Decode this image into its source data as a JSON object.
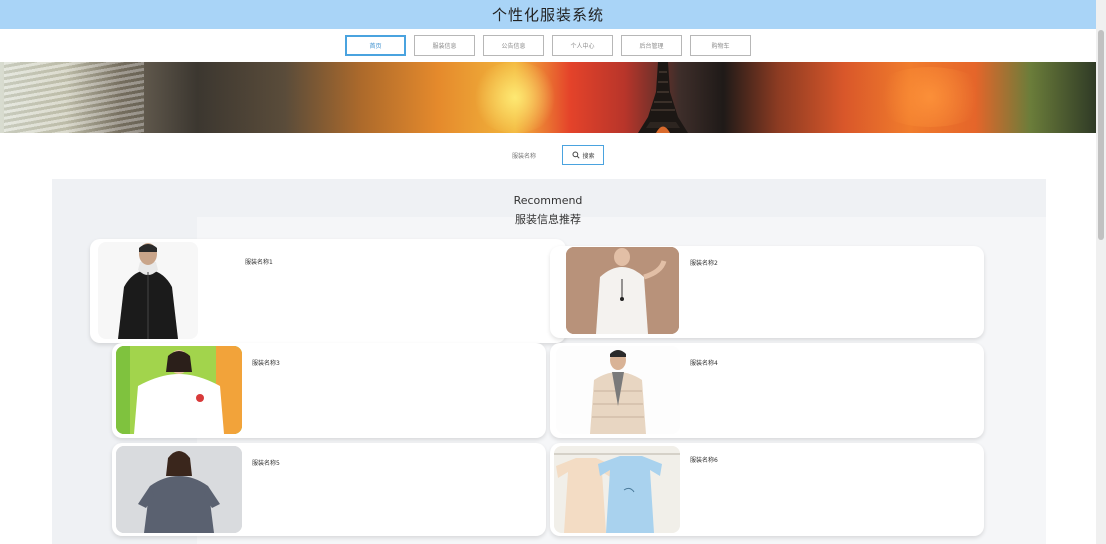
{
  "header": {
    "title": "个性化服装系统"
  },
  "nav": {
    "items": [
      {
        "label": "首页",
        "active": true
      },
      {
        "label": "服装信息",
        "active": false
      },
      {
        "label": "公告信息",
        "active": false
      },
      {
        "label": "个人中心",
        "active": false
      },
      {
        "label": "后台管理",
        "active": false
      },
      {
        "label": "购物车",
        "active": false
      }
    ]
  },
  "search": {
    "label": "服装名称",
    "button_label": "搜索",
    "icon": "search-icon"
  },
  "recommend": {
    "title_en": "Recommend",
    "title_cn": "服装信息推荐",
    "items": [
      {
        "name": "服装名称1"
      },
      {
        "name": "服装名称2"
      },
      {
        "name": "服装名称3"
      },
      {
        "name": "服装名称4"
      },
      {
        "name": "服装名称5"
      },
      {
        "name": "服装名称6"
      }
    ]
  },
  "colors": {
    "header_bg": "#a9d4f7",
    "accent": "#4aa3df",
    "section_bg": "#eff1f4"
  }
}
